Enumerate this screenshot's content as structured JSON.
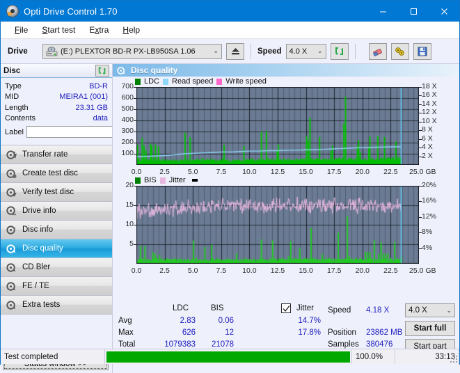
{
  "window": {
    "title": "Opti Drive Control 1.70",
    "app_icon": "disc-icon",
    "minimize": "minimize-icon",
    "maximize": "maximize-icon",
    "close": "close-icon"
  },
  "menu": [
    {
      "label": "File",
      "accel": "F"
    },
    {
      "label": "Start test",
      "accel": "S"
    },
    {
      "label": "Extra",
      "accel": "x"
    },
    {
      "label": "Help",
      "accel": "H"
    }
  ],
  "toolbar": {
    "drive_label": "Drive",
    "drive_value": "(E:)   PLEXTOR BD-R  PX-LB950SA 1.06",
    "eject_icon": "eject-icon",
    "speed_label": "Speed",
    "speed_value": "4.0 X",
    "refresh_icon": "refresh-icon",
    "erase_icon": "eraser-icon",
    "tools_icon": "tools-icon",
    "save_icon": "save-icon"
  },
  "disc_panel": {
    "title": "Disc",
    "refresh_icon": "refresh-icon",
    "rows": [
      {
        "key": "Type",
        "value": "BD-R"
      },
      {
        "key": "MID",
        "value": "MEIRA1 (001)"
      },
      {
        "key": "Length",
        "value": "23.31 GB"
      },
      {
        "key": "Contents",
        "value": "data"
      }
    ],
    "label_key": "Label",
    "label_value": "",
    "label_placeholder": "",
    "disc_icon": "disc-icon"
  },
  "nav": {
    "items": [
      {
        "label": "Transfer rate",
        "icon": "disc-transfer-icon",
        "active": false
      },
      {
        "label": "Create test disc",
        "icon": "disc-create-icon",
        "active": false
      },
      {
        "label": "Verify test disc",
        "icon": "disc-verify-icon",
        "active": false
      },
      {
        "label": "Drive info",
        "icon": "drive-info-icon",
        "active": false
      },
      {
        "label": "Disc info",
        "icon": "disc-info-icon",
        "active": false
      },
      {
        "label": "Disc quality",
        "icon": "disc-quality-icon",
        "active": true
      },
      {
        "label": "CD Bler",
        "icon": "cd-bler-icon",
        "active": false
      },
      {
        "label": "FE / TE",
        "icon": "fe-te-icon",
        "active": false
      },
      {
        "label": "Extra tests",
        "icon": "extra-tests-icon",
        "active": false
      }
    ],
    "status_window_button": "Status window >>"
  },
  "section": {
    "title": "Disc quality",
    "icon": "disc-quality-icon"
  },
  "stats": {
    "col_ldc": "LDC",
    "col_bis": "BIS",
    "jitter_label": "Jitter",
    "jitter_checked": true,
    "row_avg": "Avg",
    "row_max": "Max",
    "row_total": "Total",
    "avg_ldc": "2.83",
    "avg_bis": "0.06",
    "avg_jitter": "14.7%",
    "max_ldc": "626",
    "max_bis": "12",
    "max_jitter": "17.8%",
    "total_ldc": "1079383",
    "total_bis": "21078",
    "speed_label": "Speed",
    "speed_value": "4.18 X",
    "position_label": "Position",
    "position_value": "23862 MB",
    "samples_label": "Samples",
    "samples_value": "380476",
    "speed_select": "4.0 X",
    "start_full": "Start full",
    "start_part": "Start part"
  },
  "statusbar": {
    "message": "Test completed",
    "percent_text": "100.0%",
    "percent_value": 100,
    "elapsed": "33:13"
  },
  "colors": {
    "accent_blue": "#0078d4",
    "ldc_green": "#00c000",
    "bis_green": "#22cc22",
    "read_speed": "#8fd8f7",
    "write_speed": "#ff66cc",
    "jitter_pink": "#e7b8e0",
    "plot_bg": "#6b7b94",
    "progress_green": "#00a800",
    "value_text": "#2020c0"
  },
  "chart_data": [
    {
      "type": "line",
      "title": "LDC / Read speed",
      "xlabel": "GB",
      "ylabel": "LDC",
      "xlim": [
        0,
        25
      ],
      "ylim": [
        0,
        700
      ],
      "y2lim": [
        0,
        18
      ],
      "y2label": "X",
      "grid": true,
      "legend": [
        {
          "name": "LDC",
          "color": "#008000",
          "type": "bar"
        },
        {
          "name": "Read speed",
          "color": "#8fd8f7",
          "type": "line"
        },
        {
          "name": "Write speed",
          "color": "#ff66cc",
          "type": "line"
        }
      ],
      "xticks": [
        "0.0",
        "2.5",
        "5.0",
        "7.5",
        "10.0",
        "12.5",
        "15.0",
        "17.5",
        "20.0",
        "22.5",
        "25.0"
      ],
      "yticks": [
        100,
        200,
        300,
        400,
        500,
        600,
        700
      ],
      "y2ticks": [
        "2 X",
        "4 X",
        "6 X",
        "8 X",
        "10 X",
        "12 X",
        "14 X",
        "16 X",
        "18 X"
      ],
      "series": [
        {
          "name": "LDC",
          "color": "#00c000",
          "kind": "bars",
          "x": [
            0.05,
            0.15,
            0.3,
            0.45,
            0.55,
            0.62,
            0.7,
            0.8,
            0.9,
            1.0,
            1.05,
            1.12,
            1.2,
            1.3,
            1.4,
            1.5,
            1.62,
            1.7,
            1.8,
            1.9,
            2.0,
            2.1,
            2.2,
            2.3,
            2.4,
            2.5,
            2.6,
            2.7,
            2.8,
            2.9,
            3.0,
            3.1,
            3.25,
            3.4,
            3.5,
            3.6,
            3.75,
            3.9,
            4.0,
            4.1,
            4.25,
            4.4,
            4.55,
            4.7,
            4.85,
            4.95,
            5.0,
            5.1,
            5.2,
            5.3,
            5.4,
            5.5,
            5.6,
            5.75,
            5.9,
            6.0,
            6.1,
            6.2,
            6.3,
            6.4,
            6.5,
            6.6,
            6.7,
            6.85,
            7.0,
            7.1,
            7.25,
            7.4,
            7.5,
            7.6,
            7.7,
            7.85,
            8.0,
            8.15,
            8.3,
            8.45,
            8.6,
            8.75,
            8.9,
            9.0,
            9.15,
            9.3,
            9.45,
            9.6,
            9.75,
            9.9,
            10.0,
            10.15,
            10.3,
            10.45,
            10.6,
            10.75,
            10.9,
            11.0,
            11.15,
            11.3,
            11.45,
            11.6,
            11.7,
            11.8,
            11.9,
            12.0,
            12.1,
            12.25,
            12.4,
            12.5,
            12.6,
            12.75,
            12.9,
            13.0,
            13.15,
            13.3,
            13.45,
            13.6,
            13.75,
            13.9,
            14.0,
            14.15,
            14.3,
            14.45,
            14.6,
            14.75,
            14.9,
            15.0,
            15.15,
            15.3,
            15.45,
            15.6,
            15.75,
            15.9,
            16.0,
            16.15,
            16.3,
            16.45,
            16.6,
            16.75,
            16.9,
            17.0,
            17.15,
            17.3,
            17.45,
            17.6,
            17.75,
            17.9,
            18.0,
            18.15,
            18.3,
            18.45,
            18.6,
            18.75,
            18.9,
            19.0,
            19.1,
            19.2,
            19.35,
            19.5,
            19.6,
            19.75,
            19.9,
            20.0,
            20.1,
            20.2,
            20.35,
            20.5,
            20.6,
            20.75,
            20.9,
            21.0,
            21.15,
            21.3,
            21.45,
            21.6,
            21.75,
            21.9,
            22.0,
            22.15,
            22.3,
            22.45,
            22.6,
            22.75,
            22.9,
            23.0,
            23.15,
            23.3,
            23.4
          ],
          "y": [
            180,
            60,
            40,
            245,
            55,
            175,
            45,
            130,
            35,
            50,
            40,
            45,
            190,
            175,
            40,
            60,
            185,
            35,
            50,
            165,
            40,
            35,
            45,
            55,
            40,
            40,
            50,
            35,
            45,
            40,
            35,
            45,
            50,
            40,
            35,
            45,
            40,
            50,
            45,
            40,
            290,
            55,
            45,
            250,
            40,
            35,
            50,
            45,
            40,
            55,
            50,
            45,
            40,
            65,
            50,
            45,
            40,
            55,
            50,
            45,
            40,
            60,
            45,
            50,
            35,
            40,
            50,
            45,
            40,
            60,
            180,
            45,
            50,
            40,
            35,
            45,
            50,
            40,
            45,
            50,
            40,
            35,
            170,
            45,
            50,
            40,
            45,
            60,
            50,
            40,
            45,
            55,
            40,
            300,
            50,
            45,
            305,
            60,
            50,
            45,
            55,
            40,
            50,
            45,
            130,
            185,
            45,
            50,
            40,
            60,
            45,
            50,
            55,
            40,
            45,
            50,
            40,
            55,
            45,
            50,
            60,
            45,
            40,
            260,
            220,
            425,
            55,
            45,
            50,
            40,
            60,
            250,
            45,
            50,
            40,
            55,
            45,
            50,
            130,
            175,
            45,
            50,
            40,
            45,
            50,
            60,
            370,
            615,
            45,
            50,
            40,
            55,
            45,
            50,
            60,
            170,
            225,
            120,
            45,
            50,
            40,
            55,
            45,
            160,
            255,
            45,
            50,
            40,
            55,
            260,
            45,
            50,
            40,
            250,
            45,
            50,
            40,
            55,
            45,
            50,
            210,
            60,
            45
          ]
        },
        {
          "name": "Read speed",
          "color": "#8fd8f7",
          "kind": "line",
          "x": [
            0.0,
            1.2,
            1.9,
            2.8,
            3.8,
            4.6,
            5.2,
            6.0,
            6.8,
            7.6,
            8.4,
            9.2,
            10.0,
            10.8,
            11.6,
            12.5,
            13.4,
            14.2,
            15.0,
            15.8,
            16.6,
            17.4,
            18.2,
            19.0,
            19.8,
            20.6,
            21.4,
            22.2,
            23.0,
            23.4
          ],
          "y_x_units": [
            1.9,
            2.0,
            2.1,
            2.2,
            2.5,
            2.6,
            2.7,
            2.8,
            2.9,
            3.0,
            3.0,
            3.1,
            3.2,
            3.2,
            3.3,
            3.3,
            3.4,
            3.4,
            3.5,
            3.5,
            3.6,
            3.7,
            3.8,
            3.9,
            4.0,
            4.05,
            4.1,
            4.15,
            4.18,
            4.18
          ]
        },
        {
          "name": "Read speed end marker",
          "color": "#66ccf5",
          "kind": "vline",
          "x": 23.4
        }
      ]
    },
    {
      "type": "line",
      "title": "BIS / Jitter",
      "xlabel": "GB",
      "ylabel": "BIS",
      "xlim": [
        0,
        25
      ],
      "ylim": [
        0,
        20
      ],
      "y2lim": [
        0,
        20
      ],
      "y2label": "%",
      "grid": true,
      "legend": [
        {
          "name": "BIS",
          "color": "#008000",
          "type": "bar"
        },
        {
          "name": "Jitter",
          "color": "#e7b8e0",
          "type": "line"
        }
      ],
      "xticks": [
        "0.0",
        "2.5",
        "5.0",
        "7.5",
        "10.0",
        "12.5",
        "15.0",
        "17.5",
        "20.0",
        "22.5",
        "25.0"
      ],
      "yticks": [
        5,
        10,
        15,
        20
      ],
      "y2ticks": [
        "4%",
        "8%",
        "12%",
        "16%",
        "20%"
      ],
      "series": [
        {
          "name": "BIS",
          "color": "#22cc22",
          "kind": "bars",
          "baseline": 0.7,
          "x": [
            0.1,
            0.3,
            0.5,
            0.7,
            0.9,
            1.0,
            1.2,
            1.4,
            1.6,
            1.8,
            2.0,
            2.2,
            2.4,
            2.6,
            2.8,
            3.0,
            3.2,
            3.4,
            3.6,
            3.8,
            4.0,
            4.2,
            4.4,
            4.6,
            4.8,
            5.0,
            5.2,
            5.4,
            5.6,
            5.8,
            6.0,
            6.2,
            6.4,
            6.6,
            6.8,
            7.0,
            7.2,
            7.4,
            7.6,
            7.8,
            8.0,
            8.2,
            8.4,
            8.6,
            8.8,
            9.0,
            9.2,
            9.4,
            9.6,
            9.8,
            10.0,
            10.2,
            10.4,
            10.6,
            10.8,
            11.0,
            11.2,
            11.4,
            11.6,
            11.8,
            12.0,
            12.2,
            12.4,
            12.6,
            12.8,
            13.0,
            13.2,
            13.4,
            13.6,
            13.8,
            14.0,
            14.2,
            14.4,
            14.6,
            14.8,
            15.0,
            15.2,
            15.4,
            15.6,
            15.8,
            16.0,
            16.2,
            16.4,
            16.6,
            16.8,
            17.0,
            17.2,
            17.4,
            17.6,
            17.8,
            18.0,
            18.2,
            18.4,
            18.6,
            18.8,
            19.0,
            19.2,
            19.4,
            19.6,
            19.8,
            20.0,
            20.2,
            20.4,
            20.6,
            20.8,
            21.0,
            21.2,
            21.4,
            21.6,
            21.8,
            22.0,
            22.2,
            22.4,
            22.6,
            22.8,
            23.0,
            23.2,
            23.4
          ],
          "y": [
            1.2,
            4.6,
            1.0,
            4.5,
            1.0,
            0.9,
            1.0,
            3.0,
            2.5,
            1.0,
            2.2,
            1.0,
            0.9,
            1.0,
            1.0,
            1.2,
            1.0,
            1.0,
            1.0,
            1.0,
            1.0,
            1.2,
            1.0,
            1.0,
            1.0,
            6.0,
            1.5,
            1.0,
            1.2,
            1.0,
            4.3,
            1.0,
            1.0,
            4.9,
            1.1,
            1.0,
            1.2,
            1.0,
            1.0,
            1.1,
            1.0,
            1.0,
            1.0,
            1.0,
            2.7,
            1.0,
            1.0,
            1.0,
            1.0,
            1.0,
            1.2,
            1.0,
            1.0,
            1.0,
            1.1,
            6.2,
            1.0,
            1.0,
            1.0,
            1.0,
            6.0,
            1.0,
            1.0,
            1.2,
            1.0,
            1.0,
            1.0,
            2.0,
            5.8,
            1.0,
            1.5,
            1.0,
            4.0,
            1.0,
            1.0,
            1.0,
            1.2,
            9.2,
            1.0,
            1.0,
            1.0,
            1.0,
            2.5,
            1.0,
            1.0,
            1.0,
            1.2,
            1.0,
            1.0,
            8.0,
            1.0,
            1.2,
            1.0,
            12.2,
            2.0,
            1.0,
            1.0,
            1.0,
            1.2,
            1.0,
            1.0,
            3.0,
            3.0,
            3.0,
            1.0,
            6.0,
            1.0,
            2.6,
            5.5,
            2.6,
            2.6,
            2.6,
            1.0,
            1.0,
            5.6,
            1.0,
            1.0,
            2.0
          ]
        },
        {
          "name": "Jitter",
          "color": "#e7b8e0",
          "kind": "line",
          "mean_pct": 14.7,
          "max_pct": 17.8,
          "description": "dense noisy trace oscillating between ~13% and ~17.5%, averaging ~14.7%"
        },
        {
          "name": "Read position marker",
          "color": "#66ccf5",
          "kind": "vline",
          "x": 23.4
        }
      ]
    }
  ]
}
